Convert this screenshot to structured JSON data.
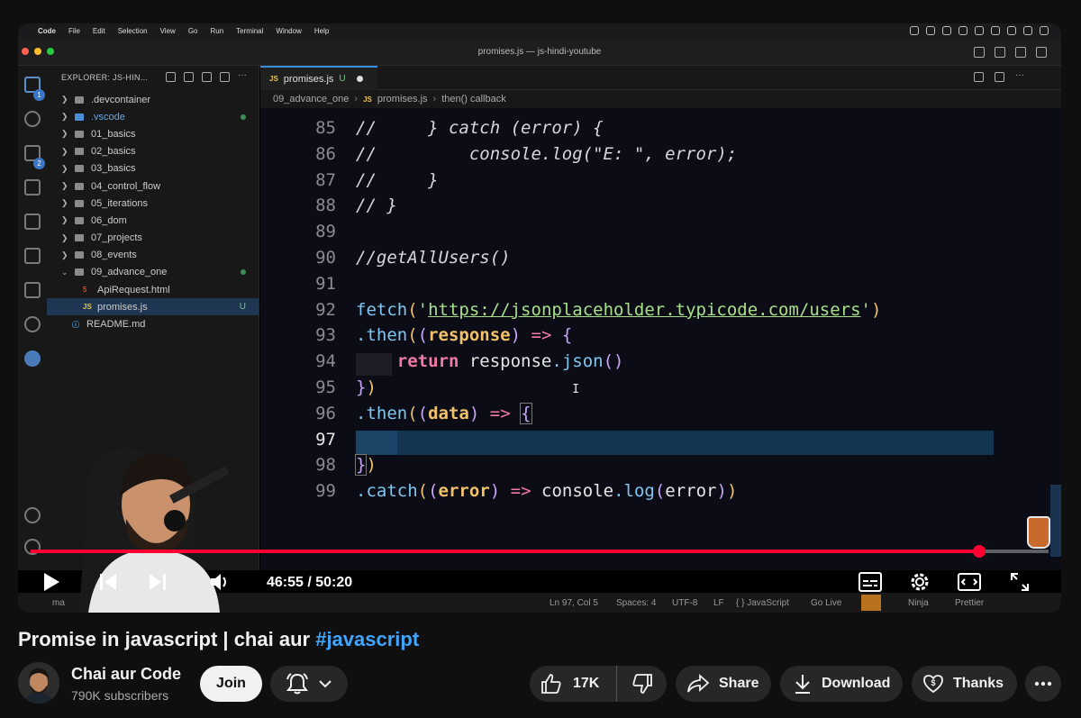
{
  "menubar": {
    "items": [
      "Code",
      "File",
      "Edit",
      "Selection",
      "View",
      "Go",
      "Run",
      "Terminal",
      "Window",
      "Help"
    ]
  },
  "window": {
    "title": "promises.js — js-hindi-youtube"
  },
  "activity_badges": {
    "explorer": "1",
    "scm": "2"
  },
  "explorer": {
    "header": "EXPLORER: JS-HIN...",
    "items": [
      {
        "label": ".devcontainer"
      },
      {
        "label": ".vscode"
      },
      {
        "label": "01_basics"
      },
      {
        "label": "02_basics"
      },
      {
        "label": "03_basics"
      },
      {
        "label": "04_control_flow"
      },
      {
        "label": "05_iterations"
      },
      {
        "label": "06_dom"
      },
      {
        "label": "07_projects"
      },
      {
        "label": "08_events"
      },
      {
        "label": "09_advance_one"
      },
      {
        "label": "ApiRequest.html"
      },
      {
        "label": "promises.js",
        "status": "U"
      },
      {
        "label": "README.md"
      }
    ]
  },
  "editor": {
    "tab": {
      "label": "promises.js",
      "status": "U"
    },
    "breadcrumb": [
      "09_advance_one",
      "promises.js",
      "then() callback"
    ],
    "line_numbers": [
      "85",
      "86",
      "87",
      "88",
      "89",
      "90",
      "91",
      "92",
      "93",
      "94",
      "95",
      "96",
      "97",
      "98",
      "99"
    ],
    "current_line": "97"
  },
  "statusbar": {
    "branch": "ma",
    "position": "Ln 97, Col 5",
    "spaces": "Spaces: 4",
    "encoding": "UTF-8",
    "eol": "LF",
    "language": "{ } JavaScript",
    "golive": "Go Live",
    "ninja": "Ninja",
    "prettier": "Prettier"
  },
  "player": {
    "current_time": "46:55",
    "duration": "50:20",
    "time_display": "46:55 / 50:20",
    "progress": 0.932,
    "accent": "#ff0033"
  },
  "video": {
    "title": "Promise in javascript | chai aur",
    "hashtag": "#javascript",
    "channel": "Chai aur Code",
    "subscribers": "790K subscribers",
    "join_label": "Join",
    "likes": "17K",
    "share_label": "Share",
    "download_label": "Download",
    "thanks_label": "Thanks"
  },
  "icons": [
    "apple-icon",
    "files-icon",
    "search-icon",
    "source-control-icon",
    "run-debug-icon",
    "extensions-icon",
    "remote-icon",
    "docker-icon",
    "account-icon",
    "settings-icon",
    "play-icon",
    "previous-icon",
    "next-icon",
    "volume-icon",
    "subtitles-icon",
    "gear-icon",
    "theater-icon",
    "fullscreen-icon",
    "bell-icon",
    "chevron-down-icon",
    "like-icon",
    "dislike-icon",
    "share-icon",
    "download-icon",
    "thanks-icon",
    "more-icon"
  ]
}
